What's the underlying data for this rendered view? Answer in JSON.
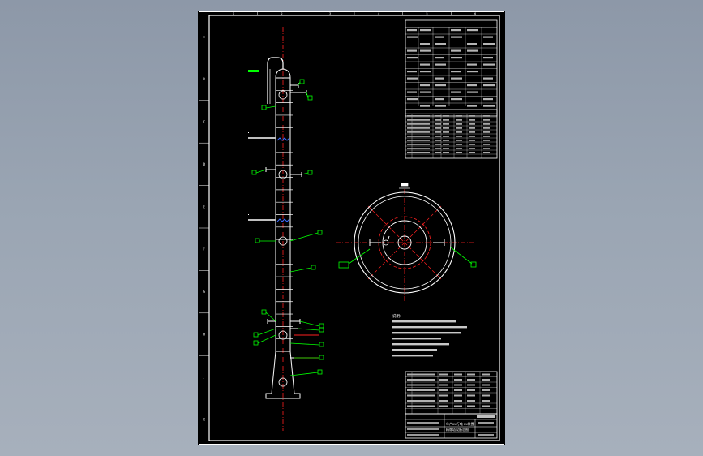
{
  "drawing": {
    "background": "#000000",
    "frame_color": "#ffffff",
    "centerline_color": "#ff2020",
    "leader_color": "#00ff00",
    "annotation_color": "#ffffff",
    "zone_letters": [
      "A",
      "B",
      "C",
      "D",
      "E",
      "F",
      "G",
      "H",
      "J",
      "K"
    ],
    "zone_numbers": [
      "1",
      "2",
      "3",
      "4",
      "5",
      "6"
    ]
  },
  "tower": {
    "section_count": 22,
    "nozzle_count": 16
  },
  "notes": {
    "heading": "说明:",
    "line_count": 7
  },
  "title_block": {
    "title_line1": "年产xx万吨 xx装置",
    "title_line2": "精馏塔设备总图"
  }
}
